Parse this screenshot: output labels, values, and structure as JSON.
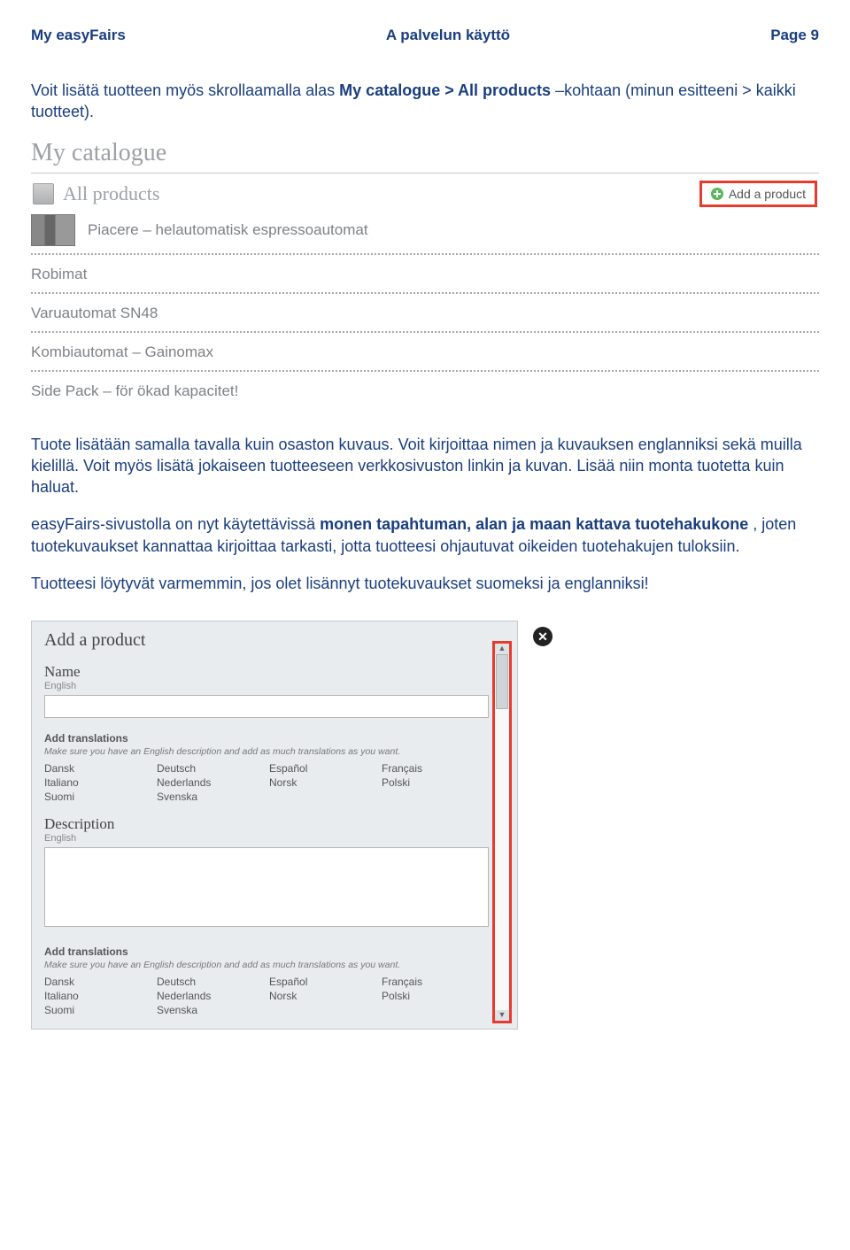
{
  "header": {
    "left": "My easyFairs",
    "center": "A palvelun käyttö",
    "right": "Page 9"
  },
  "intro_paragraph": {
    "before": "Voit lisätä tuotteen myös skrollaamalla alas ",
    "bold1": "My catalogue > All products",
    "after": " –kohtaan (minun esitteeni > kaikki tuotteet)."
  },
  "catalogue": {
    "title": "My catalogue",
    "all_products_label": "All products",
    "add_product_label": "Add a product",
    "product_rows": [
      "Piacere – helautomatisk espressoautomat",
      "Robimat",
      "Varuautomat SN48",
      "Kombiautomat – Gainomax",
      "Side Pack – för ökad kapacitet!"
    ]
  },
  "body_paragraph": {
    "p1": "Tuote lisätään samalla tavalla kuin osaston kuvaus. Voit kirjoittaa nimen ja kuvauksen englanniksi sekä muilla kielillä. Voit myös lisätä jokaiseen tuotteeseen verkkosivuston linkin ja kuvan. Lisää niin monta tuotetta kuin haluat.",
    "p2_before": "easyFairs-sivustolla on nyt käytettävissä ",
    "p2_bold": "monen tapahtuman, alan ja maan kattava tuotehakukone",
    "p2_after": ", joten tuotekuvaukset kannattaa kirjoittaa tarkasti, jotta tuotteesi ohjautuvat oikeiden tuotehakujen tuloksiin.",
    "p3": "Tuotteesi löytyvät varmemmin, jos olet lisännyt tuotekuvaukset suomeksi ja englanniksi!"
  },
  "modal": {
    "title": "Add a product",
    "name_label": "Name",
    "english_sub": "English",
    "add_translations_label": "Add translations",
    "translations_hint": "Make sure you have an English description and add as much translations as you want.",
    "languages": [
      "Dansk",
      "Deutsch",
      "Español",
      "Français",
      "Italiano",
      "Nederlands",
      "Norsk",
      "Polski",
      "Suomi",
      "Svenska"
    ],
    "description_label": "Description",
    "name_value": "",
    "description_value": ""
  }
}
